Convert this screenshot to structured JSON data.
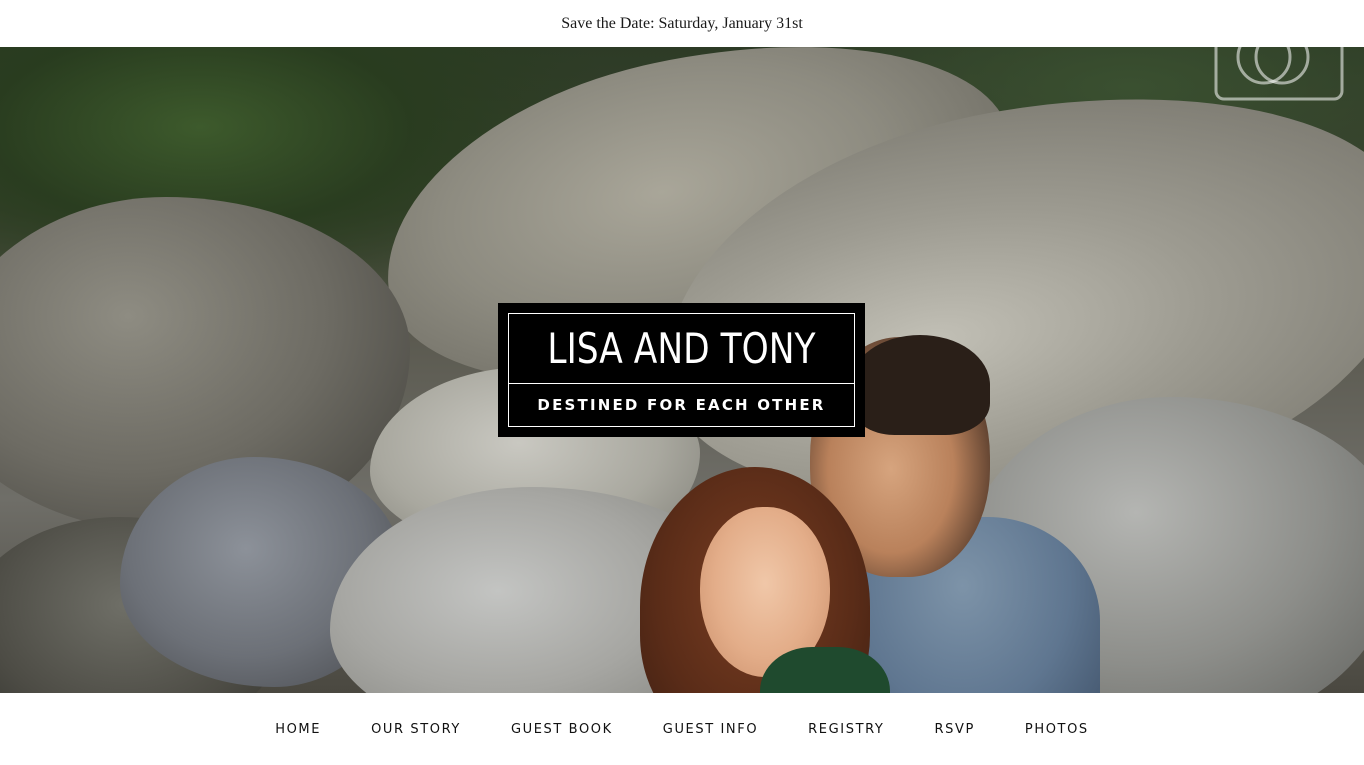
{
  "announcement": {
    "text": "Save the Date: Saturday, January 31st"
  },
  "hero": {
    "title": "LISA AND TONY",
    "subtitle": "DESTINED FOR EACH OTHER",
    "icon": "camera-icon"
  },
  "nav": {
    "items": [
      {
        "label": "HOME"
      },
      {
        "label": "OUR STORY"
      },
      {
        "label": "GUEST BOOK"
      },
      {
        "label": "GUEST INFO"
      },
      {
        "label": "REGISTRY"
      },
      {
        "label": "RSVP"
      },
      {
        "label": "PHOTOS"
      }
    ]
  },
  "colors": {
    "card_bg": "#000000",
    "text_light": "#ffffff",
    "nav_text": "#111111"
  }
}
